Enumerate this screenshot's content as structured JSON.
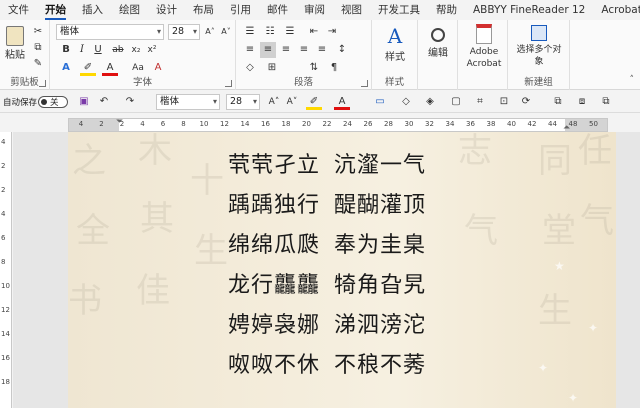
{
  "tabs": [
    "文件",
    "开始",
    "插入",
    "绘图",
    "设计",
    "布局",
    "引用",
    "邮件",
    "审阅",
    "视图",
    "开发工具",
    "帮助",
    "ABBYY FineReader 12",
    "Acrobat"
  ],
  "active_tab": "开始",
  "clipboard": {
    "paste": "粘贴",
    "label": "剪贴板"
  },
  "font": {
    "name": "楷体",
    "size": "28",
    "label": "字体",
    "bold": "B",
    "italic": "I",
    "underline": "U",
    "strike": "ab",
    "sub": "x₂",
    "sup": "x²",
    "grow": "A˄",
    "shrink": "A˅",
    "case": "Aa",
    "clear": "A"
  },
  "paragraph": {
    "label": "段落"
  },
  "styles": {
    "button": "样式",
    "label": "样式"
  },
  "editing": {
    "button": "编辑"
  },
  "adobe": {
    "button": "Adobe Acrobat"
  },
  "new_group": {
    "button": "选择多个对象",
    "label": "新建组"
  },
  "qat": {
    "autosave": "自动保存",
    "toggle": "关",
    "font": "楷体",
    "size": "28"
  },
  "ruler": {
    "h": [
      "4",
      "2",
      "2",
      "4",
      "6",
      "8",
      "10",
      "12",
      "14",
      "16",
      "18",
      "20",
      "22",
      "24",
      "26",
      "28",
      "30",
      "32",
      "34",
      "36",
      "38",
      "40",
      "42",
      "44",
      "48",
      "50"
    ],
    "v": [
      "4",
      "2",
      "2",
      "4",
      "6",
      "8",
      "10",
      "12",
      "14",
      "16",
      "18"
    ]
  },
  "poem": [
    [
      "茕茕孑立",
      "沆瀣一气"
    ],
    [
      "踽踽独行",
      "醍醐灌顶"
    ],
    [
      "绵绵瓜瓞",
      "奉为圭臬"
    ],
    [
      "龙行龘龘",
      "犄角旮旯"
    ],
    [
      "娉婷袅娜",
      "涕泗滂沱"
    ],
    [
      "呶呶不休",
      "不稂不莠"
    ]
  ],
  "colors": {
    "accent": "#185abd",
    "highlight": "#ffd800",
    "font_color": "#e01010"
  }
}
